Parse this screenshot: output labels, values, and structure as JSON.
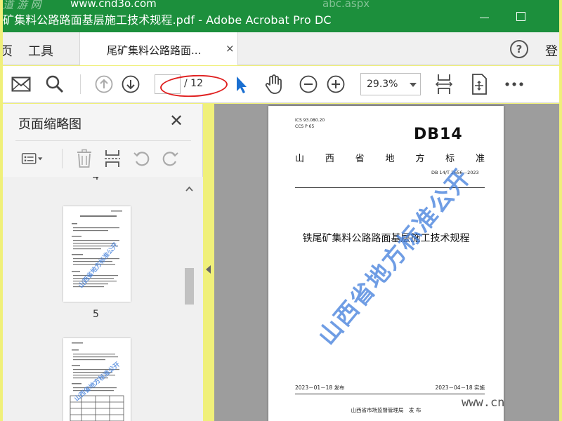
{
  "window": {
    "title": "矿集料公路路面基层施工技术规程.pdf - Adobe Acrobat Pro DC",
    "watermark_top": "道 游 网",
    "watermark_url": "www.cnd3o.com",
    "watermark_url2": "abc.aspx"
  },
  "tabs": {
    "home_partial": "页",
    "tools": "工具",
    "doc_tab_label": "尾矿集料公路路面...",
    "doc_tab_close": "×",
    "help": "?",
    "login_partial": "登"
  },
  "toolbar": {
    "current_page": "",
    "total_pages": "/ 12",
    "zoom": "29.3%",
    "icons": [
      "mail-icon",
      "search-icon",
      "page-up-icon",
      "page-down-icon",
      "select-cursor-icon",
      "hand-icon",
      "zoom-out-icon",
      "zoom-in-icon",
      "fit-width-icon",
      "scroll-mode-icon",
      "more-icon"
    ]
  },
  "left_panel": {
    "title": "页面缩略图",
    "close": "✕",
    "page_numbers": [
      "4",
      "5"
    ]
  },
  "document": {
    "ics_line1": "ICS 93.080.20",
    "ics_line2": "CCS P 65",
    "db_code": "DB14",
    "standard_chars": [
      "山",
      "西",
      "省",
      "地",
      "方",
      "标",
      "准"
    ],
    "std_number": "DB 14/T 2656—2023",
    "title": "铁尾矿集料公路路面基层施工技术规程",
    "publish_date": "2023－01－18 发布",
    "effective_date": "2023－04－18 实施",
    "publisher": "山西省市场监督管理局　发 布",
    "watermark": "山西省地方标准公开",
    "corner_watermark": "www.cn"
  },
  "colors": {
    "title_bar": "#1c8f3c",
    "annotation_red": "#e02020",
    "watermark_blue": "#4682dc",
    "frame_yellow": "#f0f07a"
  }
}
